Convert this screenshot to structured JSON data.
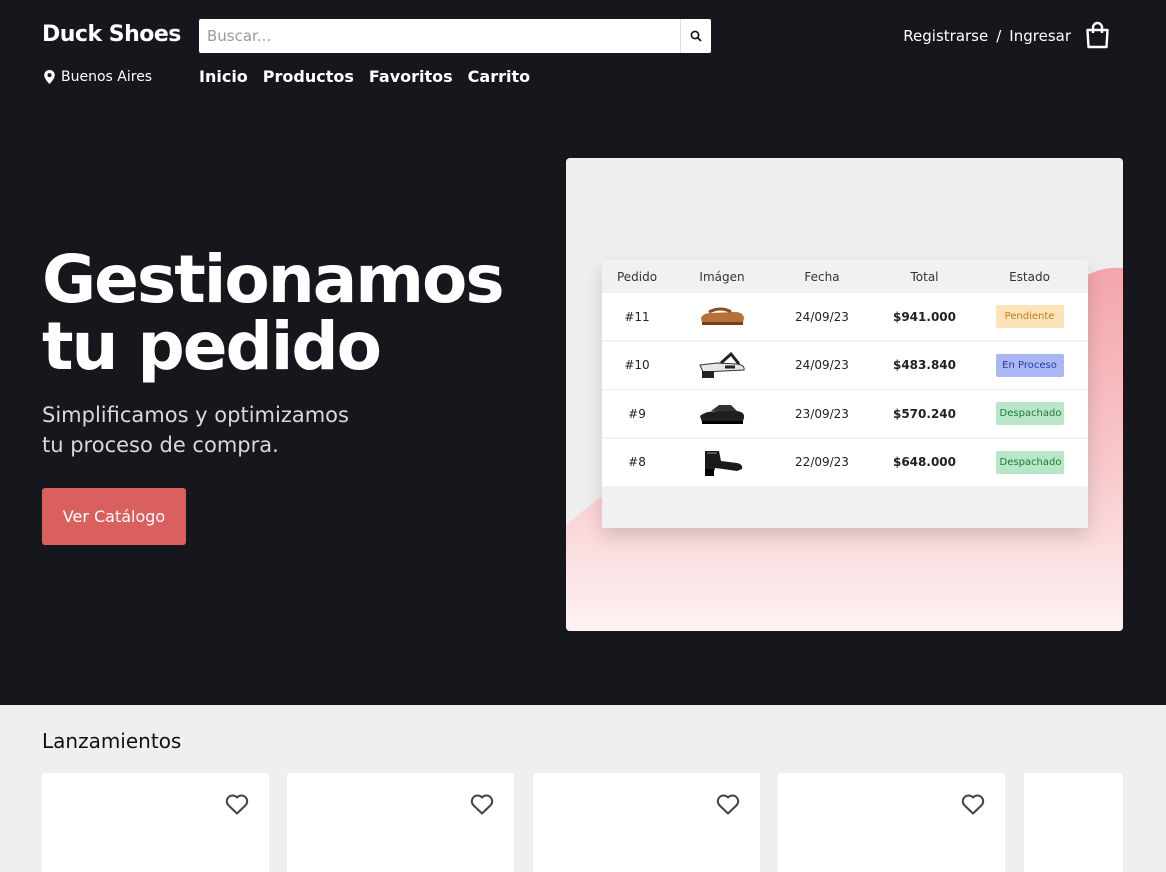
{
  "header": {
    "brand": "Duck Shoes",
    "location": "Buenos Aires",
    "search_placeholder": "Buscar...",
    "nav": [
      "Inicio",
      "Productos",
      "Favoritos",
      "Carrito"
    ],
    "register": "Registrarse",
    "separator": "/",
    "login": "Ingresar"
  },
  "hero": {
    "title_line1": "Gestionamos",
    "title_line2": "tu pedido",
    "subtitle_line1": "Simplificamos y optimizamos",
    "subtitle_line2": "tu proceso de compra.",
    "cta": "Ver Catálogo"
  },
  "orders": {
    "columns": [
      "Pedido",
      "Imágen",
      "Fecha",
      "Total",
      "Estado"
    ],
    "rows": [
      {
        "id": "#11",
        "date": "24/09/23",
        "total": "$941.000",
        "status": "Pendiente",
        "status_kind": "pending",
        "shoe_color": "#b8703a"
      },
      {
        "id": "#10",
        "date": "24/09/23",
        "total": "$483.840",
        "status": "En Proceso",
        "status_kind": "process",
        "shoe_color": "#e8e8e0"
      },
      {
        "id": "#9",
        "date": "23/09/23",
        "total": "$570.240",
        "status": "Despachado",
        "status_kind": "shipped",
        "shoe_color": "#1f1f22"
      },
      {
        "id": "#8",
        "date": "22/09/23",
        "total": "$648.000",
        "status": "Despachado",
        "status_kind": "shipped",
        "shoe_color": "#1a1a1a"
      }
    ]
  },
  "releases": {
    "title": "Lanzamientos",
    "card_count_visible": 5
  },
  "colors": {
    "background": "#15171c",
    "accent": "#d9605f",
    "pink_wave": "#f6c6c8"
  },
  "icons": [
    "location-pin-icon",
    "search-icon",
    "shopping-bag-icon",
    "heart-icon"
  ]
}
